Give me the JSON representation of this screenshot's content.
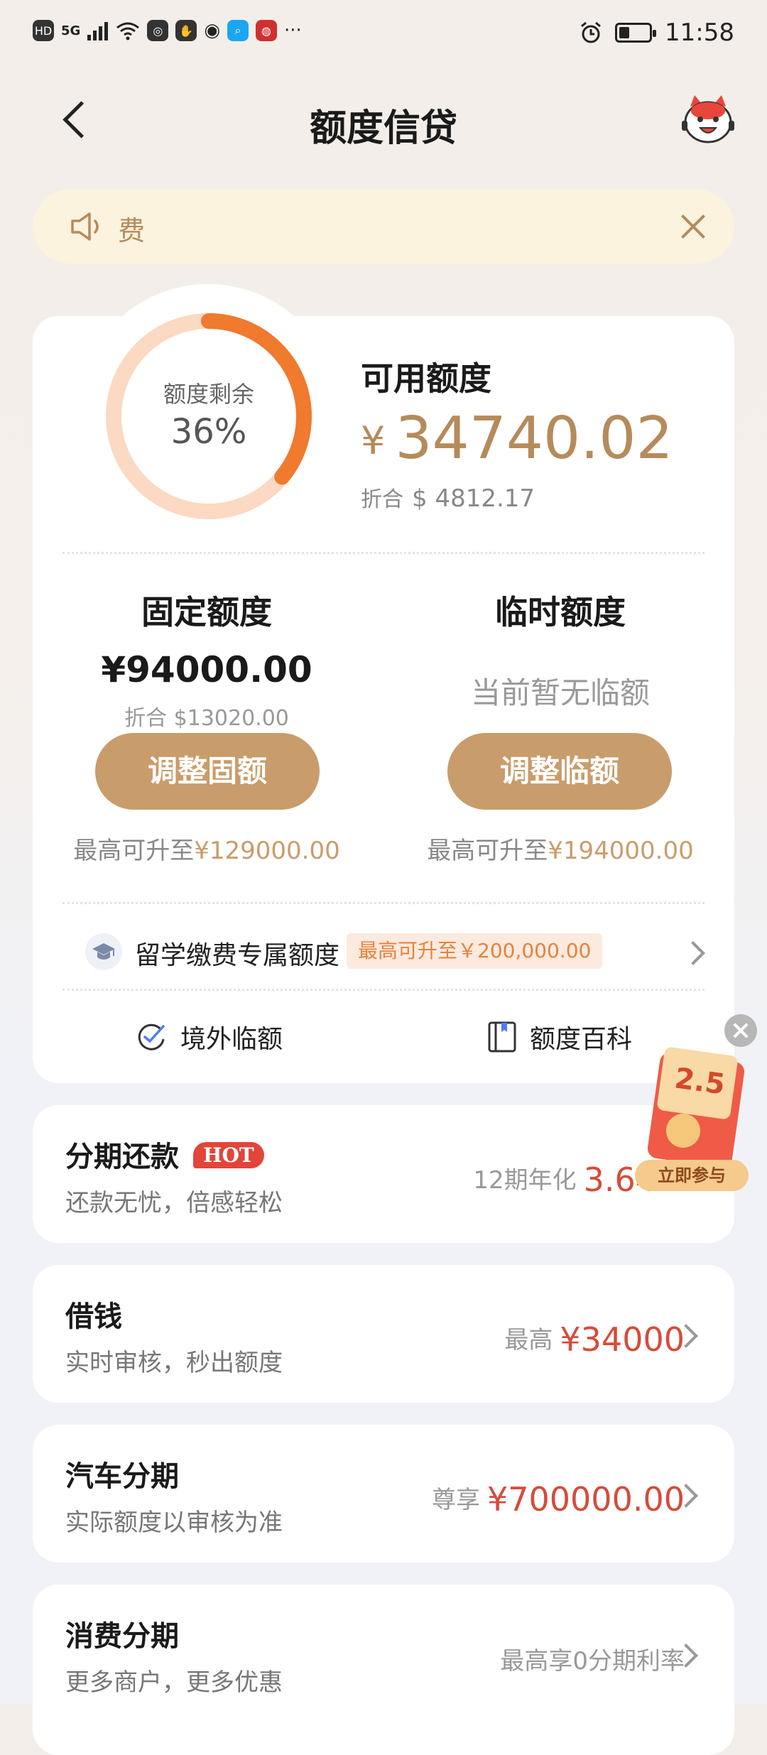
{
  "status_bar": {
    "left_text": "HD",
    "signal": "5G",
    "more": "···",
    "time": "11:58",
    "icons": [
      "hd-icon",
      "signal-icon",
      "wifi-icon",
      "app-icon",
      "hand-icon",
      "nfc-icon",
      "search-app-icon",
      "app-red-icon",
      "alarm-icon",
      "battery-icon"
    ]
  },
  "nav": {
    "title": "额度信贷"
  },
  "notice": {
    "text": "费"
  },
  "summary": {
    "ring_label": "额度剩余",
    "ring_percent_text": "36%",
    "ring_fraction": 0.36,
    "available_title": "可用额度",
    "currency": "¥",
    "available_amount": "34740.02",
    "conv_label": "折合",
    "conv_currency": "$",
    "conv_amount": "4812.17"
  },
  "fixed": {
    "title": "固定额度",
    "amount": "¥94000.00",
    "conv": "折合 $13020.00",
    "button": "调整固额",
    "max_prefix": "最高可升至",
    "max_value": "¥129000.00"
  },
  "temp": {
    "title": "临时额度",
    "status": "当前暂无临额",
    "button": "调整临额",
    "max_prefix": "最高可升至",
    "max_value": "¥194000.00"
  },
  "study": {
    "label": "留学缴费专属额度",
    "tag": "最高可升至￥200,000.00"
  },
  "links": {
    "overseas": "境外临额",
    "wiki": "额度百科"
  },
  "cards": [
    {
      "title": "分期还款",
      "badge": "HOT",
      "subtitle": "还款无忧，倍感轻松",
      "right_label": "12期年化",
      "right_value": "3.64"
    },
    {
      "title": "借钱",
      "subtitle": "实时审核，秒出额度",
      "right_label": "最高",
      "right_value": "¥34000"
    },
    {
      "title": "汽车分期",
      "subtitle": "实际额度以审核为准",
      "right_label": "尊享",
      "right_value": "¥700000.00"
    },
    {
      "title": "消费分期",
      "subtitle": "更多商户，更多优惠",
      "right_label": "最高享0分期利率",
      "right_value": ""
    }
  ],
  "promo": {
    "number": "2.5",
    "button": "立即参与"
  },
  "colors": {
    "gold": "#c99c6b",
    "ring_active": "#f07a2e",
    "ring_track": "#fbd9c3",
    "red": "#d64b3a"
  }
}
